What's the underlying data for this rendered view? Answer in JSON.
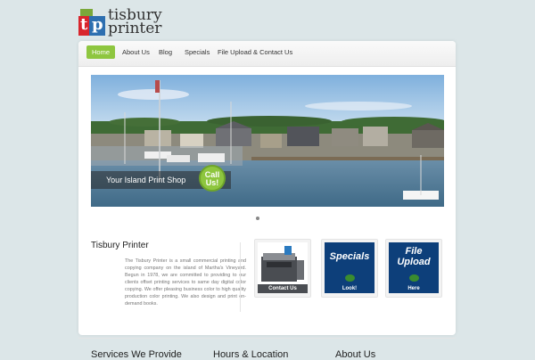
{
  "logo": {
    "line1": "tisbury",
    "line2": "printer"
  },
  "nav": {
    "items": [
      {
        "label": "Home",
        "active": true
      },
      {
        "label": "About Us"
      },
      {
        "label": "Blog"
      },
      {
        "label": "Specials"
      },
      {
        "label": "File Upload & Contact Us"
      }
    ]
  },
  "hero": {
    "tagline": "Your Island Print Shop",
    "call_us": [
      "Call",
      "Us!"
    ]
  },
  "about": {
    "title": "Tisbury Printer",
    "text": "The Tisbury Printer is a small commercial printing and copying company on the island of Martha's Vineyard. Begun in 1978, we are committed to providing to our clients offset printing services to same day digital color copying. We offer pleasing business color to high quality production color printing. We also design and print on-demand books."
  },
  "tiles": [
    {
      "label": "Contact Us"
    },
    {
      "title": "Specials",
      "label": "Look!"
    },
    {
      "title_line1": "File",
      "title_line2": "Upload",
      "label": "Here"
    }
  ],
  "footer": {
    "headings": [
      "Services We Provide",
      "Hours & Location",
      "About Us"
    ]
  },
  "colors": {
    "accent": "#8ec63f",
    "brand_blue": "#2d6fb0",
    "brand_red": "#d8262d"
  }
}
